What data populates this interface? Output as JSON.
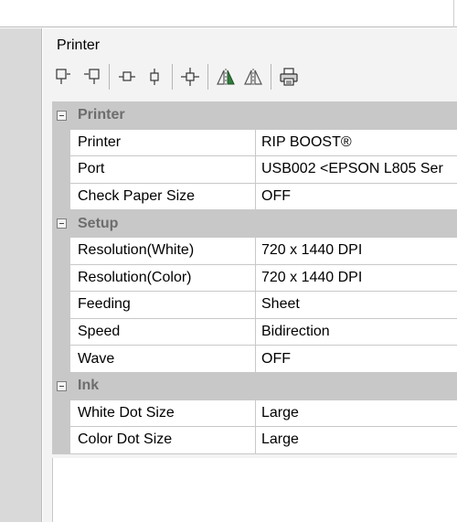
{
  "panel": {
    "title": "Printer"
  },
  "toolbar": {
    "buttons": [
      {
        "icon": "align-bottom-right-icon"
      },
      {
        "icon": "align-bottom-left-icon"
      },
      {
        "icon": "align-horizontal-center-icon"
      },
      {
        "icon": "align-vertical-center-icon"
      },
      {
        "icon": "align-center-cross-icon"
      },
      {
        "icon": "flip-horizontal-filled-icon"
      },
      {
        "icon": "flip-horizontal-outline-icon"
      },
      {
        "icon": "print-icon"
      }
    ]
  },
  "grid": {
    "categories": [
      {
        "label": "Printer",
        "rows": [
          {
            "name": "Printer",
            "value": "RIP BOOST®"
          },
          {
            "name": "Port",
            "value": "USB002  <EPSON L805 Ser"
          },
          {
            "name": "Check Paper Size",
            "value": "OFF"
          }
        ]
      },
      {
        "label": "Setup",
        "rows": [
          {
            "name": "Resolution(White)",
            "value": "720 x 1440 DPI"
          },
          {
            "name": "Resolution(Color)",
            "value": "720 x 1440 DPI"
          },
          {
            "name": "Feeding",
            "value": "Sheet"
          },
          {
            "name": "Speed",
            "value": "Bidirection"
          },
          {
            "name": "Wave",
            "value": "OFF"
          }
        ]
      },
      {
        "label": "Ink",
        "rows": [
          {
            "name": "White Dot Size",
            "value": "Large"
          },
          {
            "name": "Color Dot Size",
            "value": "Large"
          }
        ]
      }
    ]
  },
  "colors": {
    "grid_line": "#c8c8c8",
    "category_text": "#6d6d6d",
    "left_panel": "#d9d9d9",
    "panel_bg": "#f3f3f3"
  }
}
